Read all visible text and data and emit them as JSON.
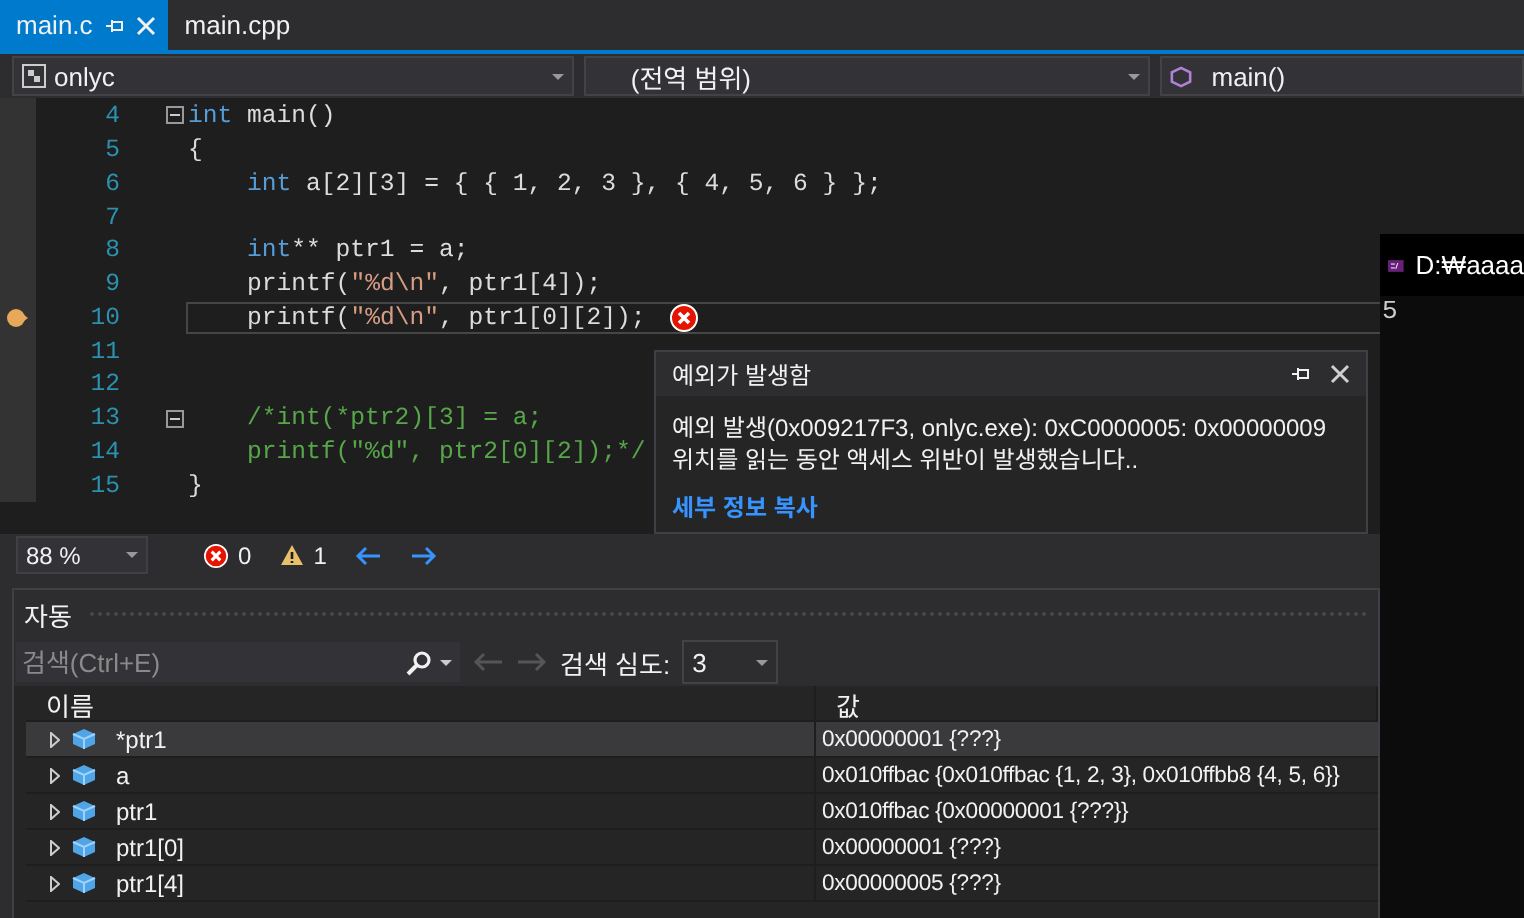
{
  "tabs": [
    {
      "label": "main.c",
      "selected": true
    },
    {
      "label": "main.cpp",
      "selected": false
    }
  ],
  "nav_bar": {
    "project": "onlyc",
    "scope": "(전역 범위)",
    "member": "main()"
  },
  "code": {
    "lines": [
      {
        "number": "4",
        "foldable": true,
        "current": false,
        "tokens": [
          {
            "text": "int",
            "kind": "keyword"
          },
          {
            "text": " main()",
            "kind": "plain"
          }
        ]
      },
      {
        "number": "5",
        "foldable": false,
        "current": false,
        "tokens": [
          {
            "text": "{",
            "kind": "brace"
          }
        ]
      },
      {
        "number": "6",
        "foldable": false,
        "current": false,
        "tokens": [
          {
            "text": "    int",
            "kind": "keyword"
          },
          {
            "text": " a[2][3] = { { 1, 2, 3 }, { 4, 5, 6 } };",
            "kind": "plain"
          }
        ]
      },
      {
        "number": "7",
        "foldable": false,
        "current": false
      },
      {
        "number": "8",
        "foldable": false,
        "current": false,
        "tokens": [
          {
            "text": "    int",
            "kind": "keyword"
          },
          {
            "text": "** ptr1 = a;",
            "kind": "plain"
          }
        ]
      },
      {
        "number": "9",
        "foldable": false,
        "current": false,
        "tokens": [
          {
            "text": "    printf(",
            "kind": "plain"
          },
          {
            "text": "\"%d\\n\"",
            "kind": "string"
          },
          {
            "text": ", ptr1[4]);",
            "kind": "plain"
          }
        ]
      },
      {
        "number": "10",
        "foldable": false,
        "current": true,
        "tokens": [
          {
            "text": "    printf(",
            "kind": "plain"
          },
          {
            "text": "\"%d\\n\"",
            "kind": "string"
          },
          {
            "text": ", ptr1[0][2]);",
            "kind": "plain"
          }
        ]
      },
      {
        "number": "11",
        "foldable": false,
        "current": false
      },
      {
        "number": "12",
        "foldable": false,
        "current": false
      },
      {
        "number": "13",
        "foldable": true,
        "current": false,
        "tokens": [
          {
            "text": "    /*int(*ptr2)[3] = a;",
            "kind": "comment"
          }
        ]
      },
      {
        "number": "14",
        "foldable": false,
        "current": false,
        "tokens": [
          {
            "text": "    printf(\"%d\", ptr2[0][2]);*/",
            "kind": "comment"
          }
        ]
      },
      {
        "number": "15",
        "foldable": false,
        "current": false,
        "tokens": [
          {
            "text": "}",
            "kind": "brace"
          }
        ]
      }
    ]
  },
  "exception_popup": {
    "title": "예외가 발생함",
    "message": "예외 발생(0x009217F3, onlyc.exe): 0xC0000005: 0x00000009 위치를 읽는 동안 액세스 위반이 발생했습니다..",
    "link": "세부 정보 복사"
  },
  "console": {
    "title": "D:₩aaaa",
    "output": "5"
  },
  "status_bar": {
    "zoom": "88 %",
    "errors": "0",
    "warnings": "1"
  },
  "autos": {
    "title": "자동",
    "search": {
      "placeholder": "검색(Ctrl+E)"
    },
    "depth_label": "검색 심도:",
    "depth": "3",
    "columns": [
      "이름",
      "값"
    ],
    "rows": [
      {
        "name": "*ptr1",
        "value": "0x00000001 {???}",
        "selected": true
      },
      {
        "name": "a",
        "value": "0x010ffbac {0x010ffbac {1, 2, 3}, 0x010ffbb8 {4, 5, 6}}",
        "selected": false
      },
      {
        "name": "ptr1",
        "value": "0x010ffbac {0x00000001 {???}}",
        "selected": false
      },
      {
        "name": "ptr1[0]",
        "value": "0x00000001 {???}",
        "selected": false
      },
      {
        "name": "ptr1[4]",
        "value": "0x00000005 {???}",
        "selected": false
      }
    ]
  }
}
